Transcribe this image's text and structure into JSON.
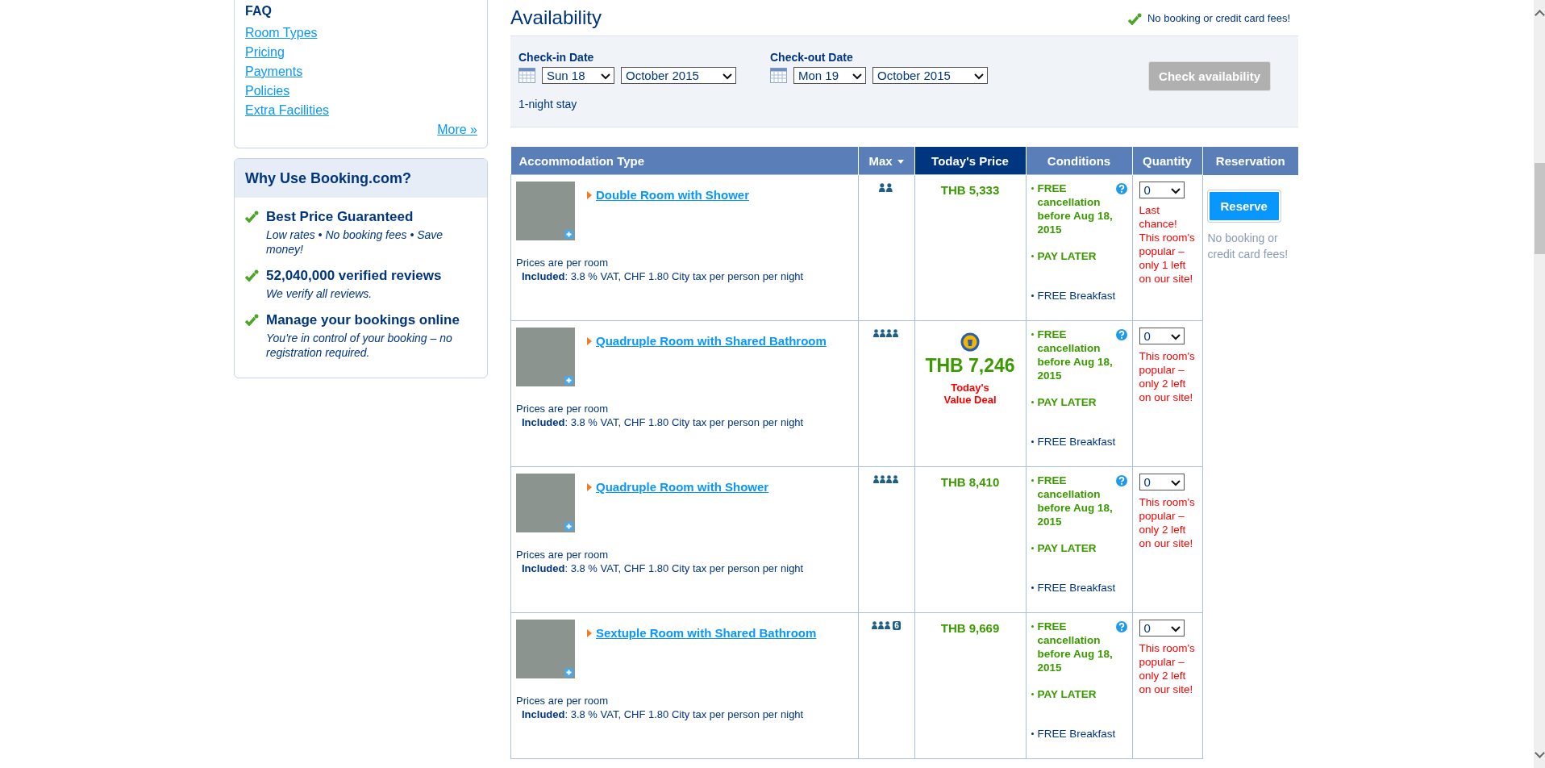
{
  "sidebar": {
    "faq": {
      "title": "FAQ",
      "links": [
        "Room Types",
        "Pricing",
        "Payments",
        "Policies",
        "Extra Facilities"
      ],
      "more": "More »"
    },
    "why": {
      "title": "Why Use Booking.com?",
      "items": [
        {
          "heading": "Best Price Guaranteed",
          "text": "Low rates  • No booking fees  • Save money!"
        },
        {
          "heading": "52,040,000 verified reviews",
          "text": "We verify all reviews."
        },
        {
          "heading": "Manage your bookings online",
          "text": "You're in control of your booking – no registration required."
        }
      ]
    }
  },
  "availability": {
    "title": "Availability",
    "fees_note": "No booking or credit card fees!",
    "checkin": {
      "label": "Check-in Date",
      "day": "Sun 18",
      "month": "October 2015"
    },
    "checkout": {
      "label": "Check-out Date",
      "day": "Mon 19",
      "month": "October 2015"
    },
    "stay": "1-night stay",
    "button": {
      "label": "Check availability",
      "disabled": true
    }
  },
  "table": {
    "columns": [
      {
        "label": "Accommodation Type",
        "kind": "plain"
      },
      {
        "label": "Max",
        "kind": "sort"
      },
      {
        "label": "Today's Price",
        "kind": "highlight"
      },
      {
        "label": "Conditions",
        "kind": "plain"
      },
      {
        "label": "Quantity",
        "kind": "plain"
      },
      {
        "label": "Reservation",
        "kind": "plain"
      }
    ],
    "reservation": {
      "button": "Reserve",
      "note": "No booking or credit card fees!"
    },
    "rows": [
      {
        "name": "Double Room with Shower",
        "occupancy": {
          "kind": "pair"
        },
        "price": "THB 5,333",
        "deal": false,
        "prices_note": "Prices are per room",
        "included": "**Included**: 3.8 % VAT, CHF 1.80 City tax per person per night",
        "conditions": [
          {
            "kind": "highlight",
            "text": "FREE cancellation before Aug 18, 2015"
          },
          {
            "kind": "highlight",
            "text": "PAY LATER"
          },
          {
            "kind": "plain",
            "text": "FREE Breakfast"
          }
        ],
        "quantity": "0",
        "urgency": "Last chance! This room's popular – only 1 left on our site!"
      },
      {
        "name": "Quadruple Room with Shared Bathroom",
        "occupancy": {
          "kind": "four"
        },
        "price": "THB 7,246",
        "deal": true,
        "deal_label": "Today's Value Deal",
        "prices_note": "Prices are per room",
        "included": "**Included**: 3.8 % VAT, CHF 1.80 City tax per person per night",
        "conditions": [
          {
            "kind": "highlight",
            "text": "FREE cancellation before Aug 18, 2015"
          },
          {
            "kind": "highlight",
            "text": "PAY LATER"
          },
          {
            "kind": "plain",
            "text": "FREE Breakfast"
          }
        ],
        "quantity": "0",
        "urgency": "This room's popular – only 2 left on our site!"
      },
      {
        "name": "Quadruple Room with Shower",
        "occupancy": {
          "kind": "four"
        },
        "price": "THB 8,410",
        "deal": false,
        "prices_note": "Prices are per room",
        "included": "**Included**: 3.8 % VAT, CHF 1.80 City tax per person per night",
        "conditions": [
          {
            "kind": "highlight",
            "text": "FREE cancellation before Aug 18, 2015"
          },
          {
            "kind": "highlight",
            "text": "PAY LATER"
          },
          {
            "kind": "plain",
            "text": "FREE Breakfast"
          }
        ],
        "quantity": "0",
        "urgency": "This room's popular – only 2 left on our site!"
      },
      {
        "name": "Sextuple Room with Shared Bathroom",
        "occupancy": {
          "kind": "group",
          "badge": "6"
        },
        "price": "THB 9,669",
        "deal": false,
        "prices_note": "Prices are per room",
        "included": "**Included**: 3.8 % VAT, CHF 1.80 City tax per person per night",
        "conditions": [
          {
            "kind": "highlight",
            "text": "FREE cancellation before Aug 18, 2015"
          },
          {
            "kind": "highlight",
            "text": "PAY LATER"
          },
          {
            "kind": "plain",
            "text": "FREE Breakfast"
          }
        ],
        "quantity": "0",
        "urgency": "This room's popular – only 2 left on our site!"
      }
    ]
  }
}
